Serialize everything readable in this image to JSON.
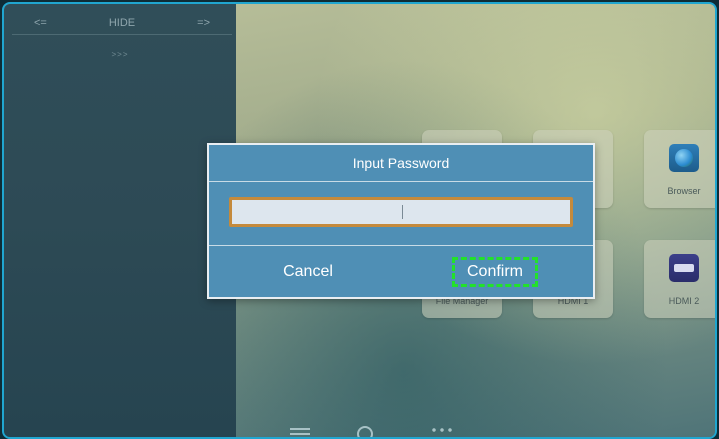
{
  "side_panel": {
    "prev_label": "<=",
    "hide_label": "HIDE",
    "next_label": "=>",
    "expand_label": ">>>"
  },
  "tiles": {
    "browser": {
      "label": "Browser",
      "icon": "browser-icon"
    },
    "hdmi2": {
      "label": "HDMI 2",
      "icon": "hdmi-icon"
    },
    "file_manager": {
      "label": "File Manager"
    },
    "hdmi1": {
      "label": "HDMI 1"
    }
  },
  "dialog": {
    "title": "Input Password",
    "password_value": "",
    "cancel_label": "Cancel",
    "confirm_label": "Confirm"
  },
  "bottom_bar": {
    "icons": [
      "menu-icon",
      "settings-icon",
      "more-icon"
    ]
  }
}
